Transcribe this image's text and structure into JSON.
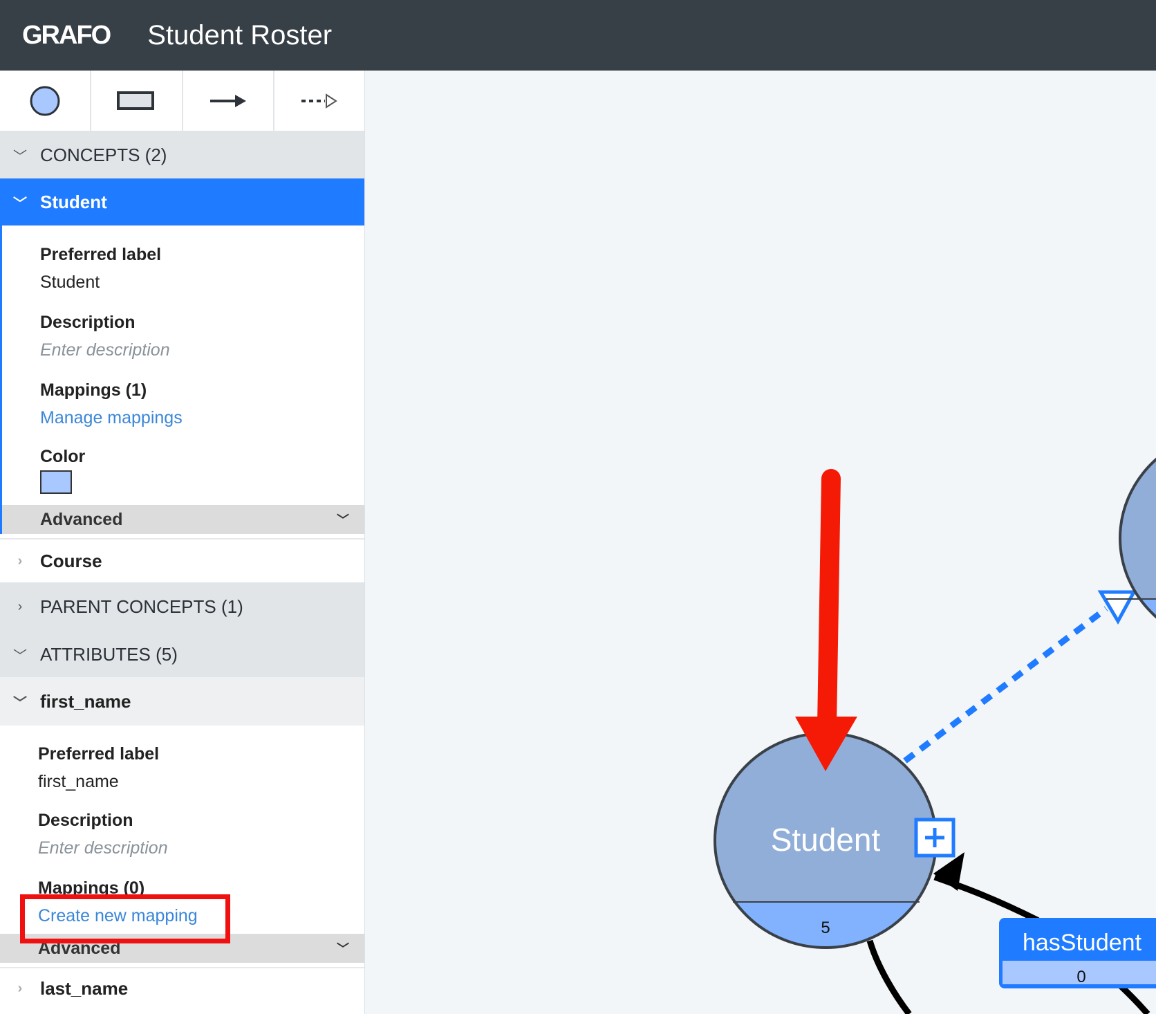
{
  "header": {
    "logo": "GRAFO",
    "title": "Student Roster"
  },
  "toolbar": {
    "tools": [
      "concept-tool",
      "relationship-box-tool",
      "relationship-arrow-tool",
      "specialization-tool"
    ]
  },
  "sidebar": {
    "concepts_header": "CONCEPTS (2)",
    "selected_concept": "Student",
    "concept_details": {
      "preferred_label_title": "Preferred label",
      "preferred_label": "Student",
      "description_title": "Description",
      "description_placeholder": "Enter description",
      "mappings_title": "Mappings (1)",
      "mappings_link": "Manage mappings",
      "color_title": "Color",
      "color": "#a8c8ff",
      "advanced": "Advanced"
    },
    "course": "Course",
    "parent_concepts_header": "PARENT CONCEPTS (1)",
    "attributes_header": "ATTRIBUTES (5)",
    "selected_attribute": "first_name",
    "attribute_details": {
      "preferred_label_title": "Preferred label",
      "preferred_label": "first_name",
      "description_title": "Description",
      "description_placeholder": "Enter description",
      "mappings_title": "Mappings (0)",
      "mappings_link": "Create new mapping",
      "advanced": "Advanced"
    },
    "last_name": "last_name"
  },
  "canvas": {
    "student_node": {
      "label": "Student",
      "count": "5"
    },
    "relationship": {
      "label": "hasStudent",
      "count": "0"
    }
  },
  "colors": {
    "header": "#373f47",
    "accent": "#1f7bff",
    "node_fill": "#91aed8",
    "node_count_fill": "#82b1fe",
    "annotation": "#f51a05"
  }
}
